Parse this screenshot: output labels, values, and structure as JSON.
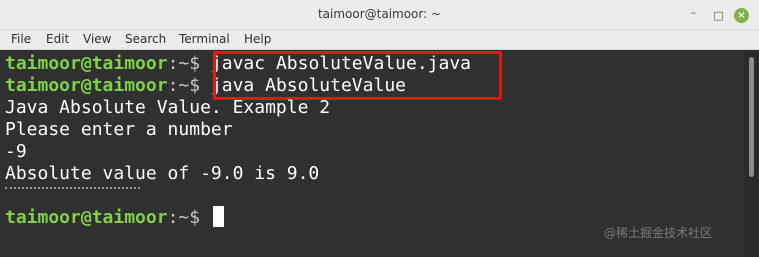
{
  "window": {
    "title": "taimoor@taimoor: ~",
    "controls": {
      "minimize": "–",
      "maximize": "□",
      "close": "×"
    }
  },
  "menubar": {
    "items": [
      "File",
      "Edit",
      "View",
      "Search",
      "Terminal",
      "Help"
    ]
  },
  "terminal": {
    "prompt_user": "taimoor@taimoor",
    "prompt_path": ":~$ ",
    "lines": {
      "cmd1": "javac AbsoluteValue.java",
      "cmd2": "java AbsoluteValue",
      "out1": "Java Absolute Value. Example 2",
      "out2": "Please enter a number",
      "out3": "-9",
      "out4": "Absolute value of -9.0 is 9.0"
    },
    "highlight_color": "#e01818"
  },
  "watermark": "@稀土掘金技术社区"
}
